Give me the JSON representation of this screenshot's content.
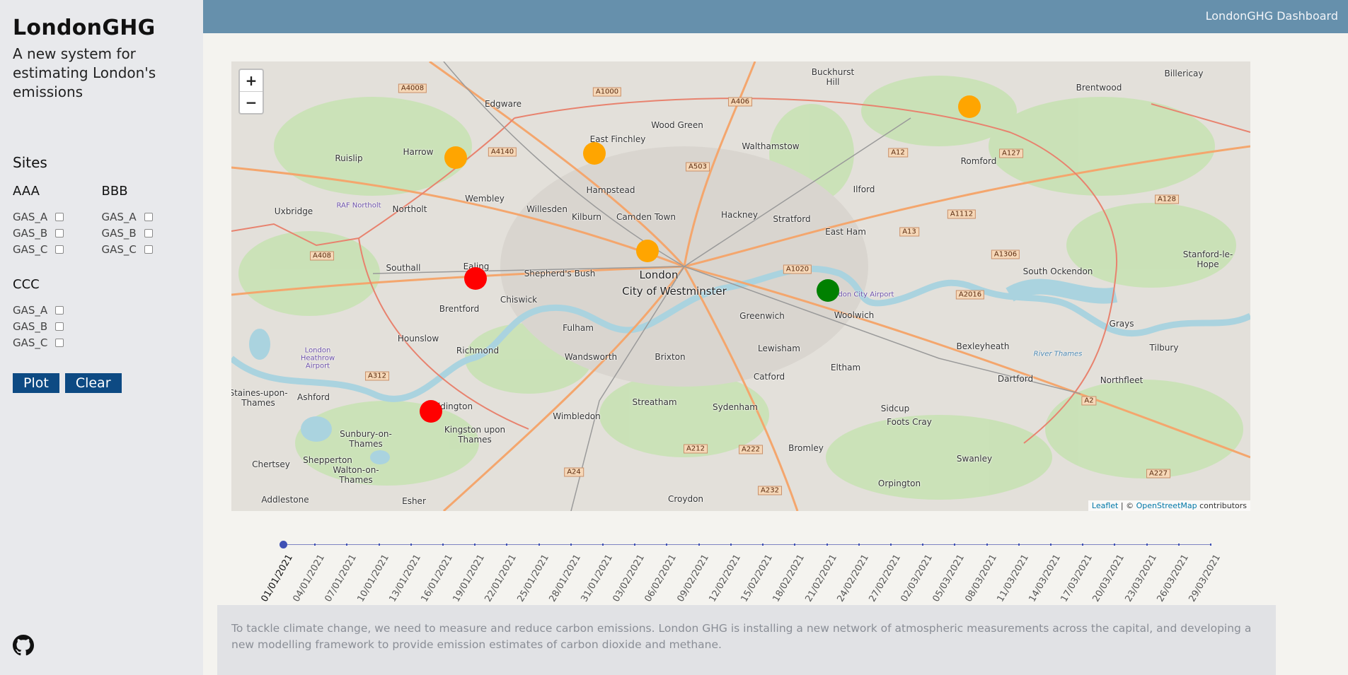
{
  "sidebar": {
    "title": "LondonGHG",
    "subtitle": "A new system for estimating London's emissions",
    "sites_heading": "Sites",
    "sites": [
      {
        "name": "AAA",
        "gases": [
          "GAS_A",
          "GAS_B",
          "GAS_C"
        ]
      },
      {
        "name": "BBB",
        "gases": [
          "GAS_A",
          "GAS_B",
          "GAS_C"
        ]
      },
      {
        "name": "CCC",
        "gases": [
          "GAS_A",
          "GAS_B",
          "GAS_C"
        ]
      }
    ],
    "plot_label": "Plot",
    "clear_label": "Clear",
    "github_icon": "github-icon"
  },
  "header": {
    "title": "LondonGHG Dashboard"
  },
  "map": {
    "zoom_in": "+",
    "zoom_out": "−",
    "attribution": {
      "leaflet": "Leaflet",
      "sep": " | © ",
      "osm": "OpenStreetMap",
      "suffix": " contributors"
    },
    "marker_colors": {
      "orange": "#ffa500",
      "red": "#ff0000",
      "green": "#008000"
    },
    "places": [
      "London",
      "City of Westminster",
      "Camden Town",
      "Hackney",
      "Stratford",
      "Walthamstow",
      "Wood Green",
      "Edgware",
      "East Finchley",
      "Hampstead",
      "Kilburn",
      "Willesden",
      "Wembley",
      "Harrow",
      "Ruislip",
      "Northolt",
      "Uxbridge",
      "Southall",
      "Ealing",
      "Shepherd's Bush",
      "Chiswick",
      "Brentford",
      "Hounslow",
      "Richmond",
      "Fulham",
      "Wandsworth",
      "Brixton",
      "Greenwich",
      "Lewisham",
      "Catford",
      "Sydenham",
      "Streatham",
      "Wimbledon",
      "Teddington",
      "Kingston upon Thames",
      "Sunbury-on-Thames",
      "Staines-upon-Thames",
      "Ashford",
      "Shepperton",
      "Walton-on-Thames",
      "Chertsey",
      "Addlestone",
      "Esher",
      "Croydon",
      "Bromley",
      "Orpington",
      "Sidcup",
      "Foots Cray",
      "Eltham",
      "Woolwich",
      "Bexleyheath",
      "Dartford",
      "Swanley",
      "Northfleet",
      "Grays",
      "Tilbury",
      "South Ockendon",
      "Stanford-le-Hope",
      "Romford",
      "Brentwood",
      "Billericay",
      "Ilford",
      "East Ham",
      "Buckhurst Hill",
      "London Heathrow Airport",
      "RAF Northolt",
      "London City Airport",
      "River Thames"
    ],
    "roads": [
      "A4008",
      "A1000",
      "A406",
      "A4140",
      "A503",
      "A12",
      "A127",
      "A128",
      "A1112",
      "A13",
      "A1306",
      "A1020",
      "A2016",
      "A408",
      "A312",
      "A212",
      "A222",
      "A24",
      "A232",
      "A2",
      "A227"
    ]
  },
  "timeline": {
    "dates": [
      "01/01/2021",
      "04/01/2021",
      "07/01/2021",
      "10/01/2021",
      "13/01/2021",
      "16/01/2021",
      "19/01/2021",
      "22/01/2021",
      "25/01/2021",
      "28/01/2021",
      "31/01/2021",
      "03/02/2021",
      "06/02/2021",
      "09/02/2021",
      "12/02/2021",
      "15/02/2021",
      "18/02/2021",
      "21/02/2021",
      "24/02/2021",
      "27/02/2021",
      "02/03/2021",
      "05/03/2021",
      "08/03/2021",
      "11/03/2021",
      "14/03/2021",
      "17/03/2021",
      "20/03/2021",
      "23/03/2021",
      "26/03/2021",
      "29/03/2021"
    ],
    "selected": "01/01/2021"
  },
  "info": {
    "text": "To tackle climate change, we need to measure and reduce carbon emissions. London GHG is installing a new network of atmospheric measurements across the capital, and developing a new modelling framework to provide emission estimates of carbon dioxide and methane."
  }
}
